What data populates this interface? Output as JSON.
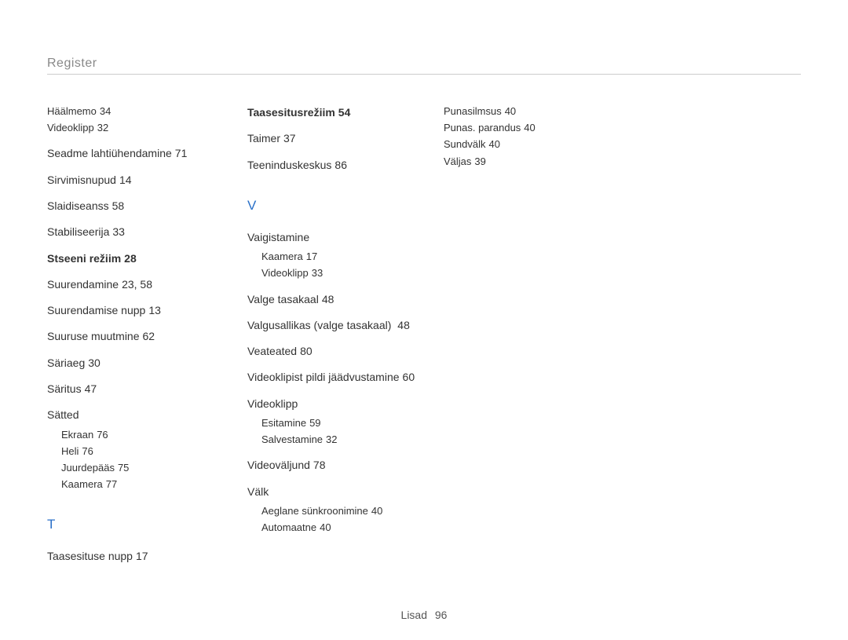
{
  "header": {
    "title": "Register"
  },
  "footer": {
    "label": "Lisad",
    "page": "96"
  },
  "col1": {
    "s_entries": [
      {
        "subs": [
          {
            "label": "Häälmemo",
            "page": "34"
          },
          {
            "label": "Videoklipp",
            "page": "32"
          }
        ]
      },
      {
        "label": "Seadme lahtiühendamine",
        "page": "71"
      },
      {
        "label": "Sirvimisnupud",
        "page": "14"
      },
      {
        "label": "Slaidiseanss",
        "page": "58"
      },
      {
        "label": "Stabiliseerija",
        "page": "33"
      },
      {
        "label": "Stseeni režiim",
        "page": "28",
        "bold": true
      },
      {
        "label": "Suurendamine",
        "page": "23, 58"
      },
      {
        "label": "Suurendamise nupp",
        "page": "13"
      },
      {
        "label": "Suuruse muutmine",
        "page": "62"
      },
      {
        "label": "Säriaeg",
        "page": "30"
      },
      {
        "label": "Säritus",
        "page": "47"
      },
      {
        "label": "Sätted",
        "subs": [
          {
            "label": "Ekraan",
            "page": "76"
          },
          {
            "label": "Heli",
            "page": "76"
          },
          {
            "label": "Juurdepääs",
            "page": "75"
          },
          {
            "label": "Kaamera",
            "page": "77"
          }
        ]
      }
    ],
    "section_letter_T": "T",
    "t_entries": [
      {
        "label": "Taasesituse nupp",
        "page": "17"
      }
    ]
  },
  "col2": {
    "t_entries": [
      {
        "label": "Taasesitusrežiim",
        "page": "54",
        "bold": true
      },
      {
        "label": "Taimer",
        "page": "37"
      },
      {
        "label": "Teeninduskeskus",
        "page": "86"
      }
    ],
    "section_letter_V": "V",
    "v_entries": [
      {
        "label": "Vaigistamine",
        "subs": [
          {
            "label": "Kaamera",
            "page": "17"
          },
          {
            "label": "Videoklipp",
            "page": "33"
          }
        ]
      },
      {
        "label": "Valge tasakaal",
        "page": "48"
      },
      {
        "label": "Valgusallikas (valge tasakaal)",
        "page": "48"
      },
      {
        "label": "Veateated",
        "page": "80"
      },
      {
        "label": "Videoklipist pildi jäädvustamine",
        "page": "60"
      },
      {
        "label": "Videoklipp",
        "subs": [
          {
            "label": "Esitamine",
            "page": "59"
          },
          {
            "label": "Salvestamine",
            "page": "32"
          }
        ]
      },
      {
        "label": "Videoväljund",
        "page": "78"
      },
      {
        "label": "Välk",
        "subs": [
          {
            "label": "Aeglane sünkroonimine",
            "page": "40"
          },
          {
            "label": "Automaatne",
            "page": "40"
          }
        ]
      }
    ]
  },
  "col3": {
    "v_entries": [
      {
        "subs": [
          {
            "label": "Punasilmsus",
            "page": "40"
          },
          {
            "label": "Punas. parandus",
            "page": "40"
          },
          {
            "label": "Sundvälk",
            "page": "40"
          },
          {
            "label": "Väljas",
            "page": "39"
          }
        ]
      }
    ]
  }
}
